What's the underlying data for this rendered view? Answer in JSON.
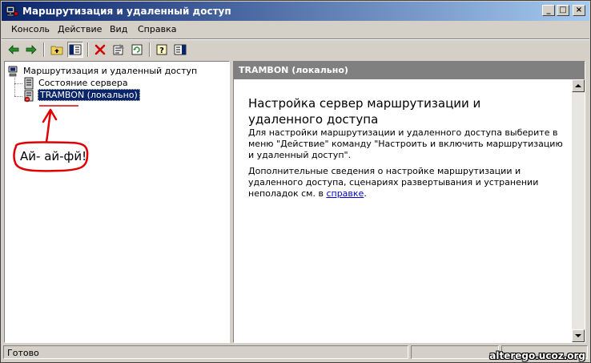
{
  "window": {
    "title": "Маршрутизация и удаленный доступ",
    "minimize_label": "_",
    "maximize_label": "□",
    "close_label": "×"
  },
  "menu": {
    "items": [
      {
        "label": "Консоль"
      },
      {
        "label": "Действие"
      },
      {
        "label": "Вид"
      },
      {
        "label": "Справка"
      }
    ]
  },
  "toolbar": {
    "buttons": [
      {
        "icon": "back-arrow-icon"
      },
      {
        "icon": "forward-arrow-icon"
      },
      {
        "icon": "up-folder-icon"
      },
      {
        "icon": "show-hide-tree-icon"
      },
      {
        "icon": "delete-icon"
      },
      {
        "icon": "properties-icon"
      },
      {
        "icon": "refresh-icon"
      },
      {
        "icon": "help-icon"
      },
      {
        "icon": "show-hide-action-pane-icon"
      }
    ]
  },
  "tree": {
    "root": "Маршрутизация и удаленный доступ",
    "items": [
      {
        "label": "Состояние сервера"
      },
      {
        "label": "TRAMBON (локально)",
        "selected": true
      }
    ]
  },
  "annotation": {
    "text": "Ай- ай-фй!",
    "color": "#e00000"
  },
  "details": {
    "header": "TRAMBON (локально)",
    "title": "Настройка сервер маршрутизации и удаленного доступа",
    "paragraph1": "Для настройки маршрутизации и удаленного доступа выберите в меню \"Действие\" команду \"Настроить и включить маршрутизацию и удаленный доступ\".",
    "paragraph2_prefix": "Дополнительные сведения о настройке маршрутизации и удаленного доступа, сценариях развертывания и устранении неполадок см. в ",
    "paragraph2_link": "справке",
    "paragraph2_suffix": "."
  },
  "statusbar": {
    "text": "Готово"
  },
  "watermark": {
    "text": "alterego.ucoz.org"
  },
  "colors": {
    "title_gradient_start": "#0a246a",
    "title_gradient_end": "#a6caf0",
    "pane_header": "#808080",
    "selection": "#0a246a",
    "link": "#0000cc",
    "chrome": "#d4d0c8"
  }
}
